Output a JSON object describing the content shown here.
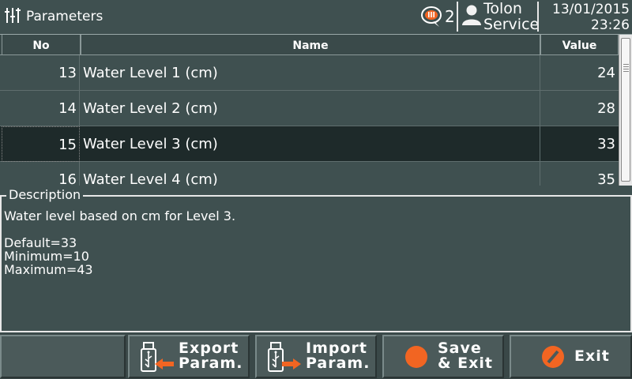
{
  "header": {
    "title": "Parameters",
    "alarm_count": "2",
    "user_line1": "Tolon",
    "user_line2": "Service",
    "date": "13/01/2015",
    "time": "23:26"
  },
  "table": {
    "columns": [
      "No",
      "Name",
      "Value"
    ],
    "rows": [
      {
        "no": "13",
        "name": "Water Level 1 (cm)",
        "value": "24",
        "selected": false
      },
      {
        "no": "14",
        "name": "Water Level 2 (cm)",
        "value": "28",
        "selected": false
      },
      {
        "no": "15",
        "name": "Water Level 3 (cm)",
        "value": "33",
        "selected": true
      },
      {
        "no": "16",
        "name": "Water Level 4 (cm)",
        "value": "35",
        "selected": false
      }
    ]
  },
  "description": {
    "legend": "Description",
    "line1": "Water level based on cm for Level 3.",
    "line2": "",
    "line3": "Default=33",
    "line4": "Minimum=10",
    "line5": "Maximum=43"
  },
  "footer": {
    "export_label": "Export\nParam.",
    "import_label": "Import\nParam.",
    "save_label": "Save\n& Exit",
    "exit_label": "Exit"
  },
  "colors": {
    "background": "#3f5050",
    "selected_row": "#1e2a2a",
    "accent_orange": "#f26522"
  },
  "icons": {
    "menu": "parameters-menu-icon",
    "alarm": "alarm-bubble-icon",
    "user": "user-icon",
    "export": "usb-export-icon",
    "import": "usb-import-icon",
    "save": "orange-circle-icon",
    "exit": "exit-slash-icon"
  }
}
